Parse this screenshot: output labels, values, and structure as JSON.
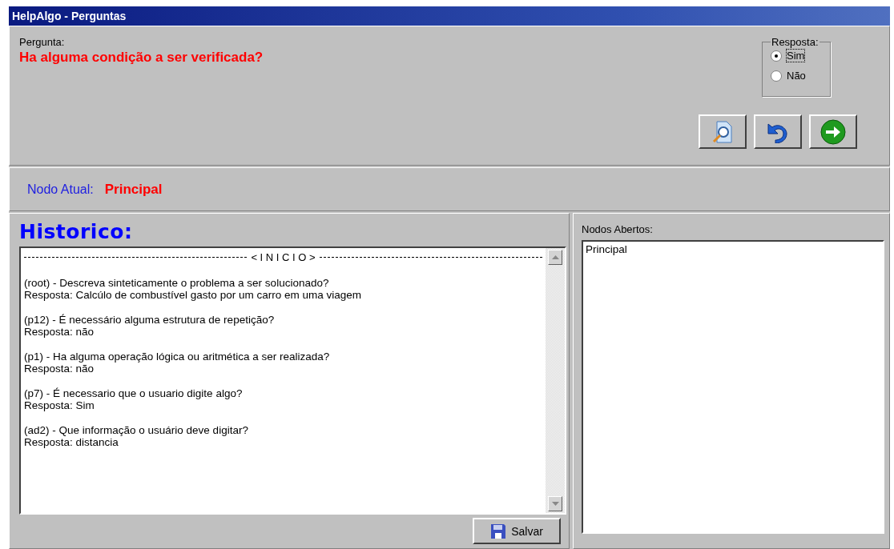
{
  "window": {
    "title": "HelpAlgo - Perguntas"
  },
  "question": {
    "label": "Pergunta:",
    "text": "Ha alguma condição a ser verificada?"
  },
  "answer_group": {
    "label": "Resposta:",
    "options": [
      {
        "label": "Sim",
        "selected": true
      },
      {
        "label": "Não",
        "selected": false
      }
    ]
  },
  "toolbar": [
    {
      "kind": "preview"
    },
    {
      "kind": "undo"
    },
    {
      "kind": "next"
    }
  ],
  "current_node": {
    "label": "Nodo Atual:",
    "value": "Principal"
  },
  "history": {
    "title": "Historico:",
    "start_marker": "< I N I C I O >",
    "entries": [
      {
        "question": "(root) - Descreva sinteticamente o problema a ser solucionado?",
        "answer": "Resposta: Calcúlo de combustível gasto por um carro em uma viagem"
      },
      {
        "question": "(p12) - É necessário alguma estrutura de repetição?",
        "answer": "Resposta: não"
      },
      {
        "question": "(p1) - Ha alguma operação lógica ou aritmética a ser realizada?",
        "answer": "Resposta: não"
      },
      {
        "question": "(p7) - É necessario que o usuario digite algo?",
        "answer": "Resposta: Sim"
      },
      {
        "question": "(ad2) - Que informação o usuário deve digitar?",
        "answer": "Resposta: distancia"
      }
    ],
    "save_button": "Salvar"
  },
  "open_nodes": {
    "label": "Nodos Abertos:",
    "items": [
      "Principal"
    ]
  }
}
